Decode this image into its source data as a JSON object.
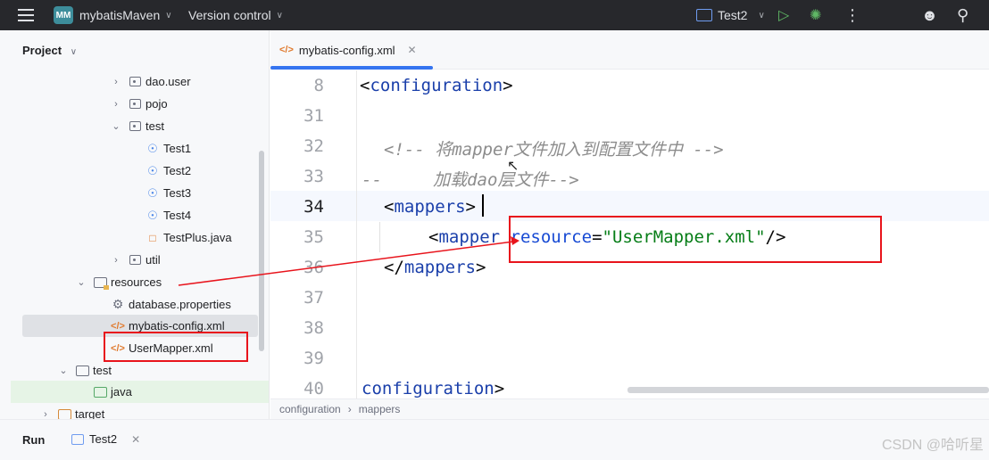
{
  "titlebar": {
    "project_badge": "MM",
    "project_name": "mybatisMaven",
    "version_control": "Version control",
    "run_config": "Test2"
  },
  "project_panel": {
    "header": "Project",
    "items": [
      {
        "label": "dao.user",
        "icon": "package-icon"
      },
      {
        "label": "pojo",
        "icon": "package-icon"
      },
      {
        "label": "test",
        "icon": "package-icon"
      },
      {
        "label": "Test1",
        "icon": "test-class-icon"
      },
      {
        "label": "Test2",
        "icon": "test-class-icon"
      },
      {
        "label": "Test3",
        "icon": "test-class-icon"
      },
      {
        "label": "Test4",
        "icon": "test-class-icon"
      },
      {
        "label": "TestPlus.java",
        "icon": "java-file-icon"
      },
      {
        "label": "util",
        "icon": "package-icon"
      },
      {
        "label": "resources",
        "icon": "resources-folder-icon"
      },
      {
        "label": "database.properties",
        "icon": "gear-icon"
      },
      {
        "label": "mybatis-config.xml",
        "icon": "xml-file-icon"
      },
      {
        "label": "UserMapper.xml",
        "icon": "xml-file-icon"
      },
      {
        "label": "test",
        "icon": "folder-icon"
      },
      {
        "label": "java",
        "icon": "folder-icon"
      },
      {
        "label": "target",
        "icon": "folder-icon"
      }
    ]
  },
  "editor": {
    "tab_label": "mybatis-config.xml",
    "line_numbers": [
      "8",
      "31",
      "32",
      "33",
      "34",
      "35",
      "36",
      "37",
      "38",
      "39",
      "40"
    ],
    "code": {
      "l8_open": "<",
      "l8_tag": "configuration",
      "l8_close": ">",
      "l32_comment": "<!-- 将mapper文件加入到配置文件中 -->",
      "l33_comment": "--     加载dao层文件-->",
      "l34_open": "<",
      "l34_tag": "mappers",
      "l34_close": ">",
      "l35_open": "<",
      "l35_tag": "mapper",
      "l35_attr": "resource",
      "l35_eq": "=",
      "l35_value": "\"UserMapper.xml\"",
      "l35_close": "/>",
      "l36_open": "</",
      "l36_tag": "mappers",
      "l36_close": ">",
      "l40_tag": "configuration",
      "l40_close": ">"
    },
    "breadcrumb": [
      "configuration",
      "mappers"
    ],
    "breadcrumb_separator": "›"
  },
  "runbar": {
    "label": "Run",
    "tab": "Test2"
  },
  "watermark": "CSDN @哈听星",
  "colors": {
    "titlebar_bg": "#27282c",
    "accent": "#3574f0",
    "annotation": "#e8141c",
    "xml_tag": "#1a3faa",
    "xml_string": "#067d17"
  }
}
